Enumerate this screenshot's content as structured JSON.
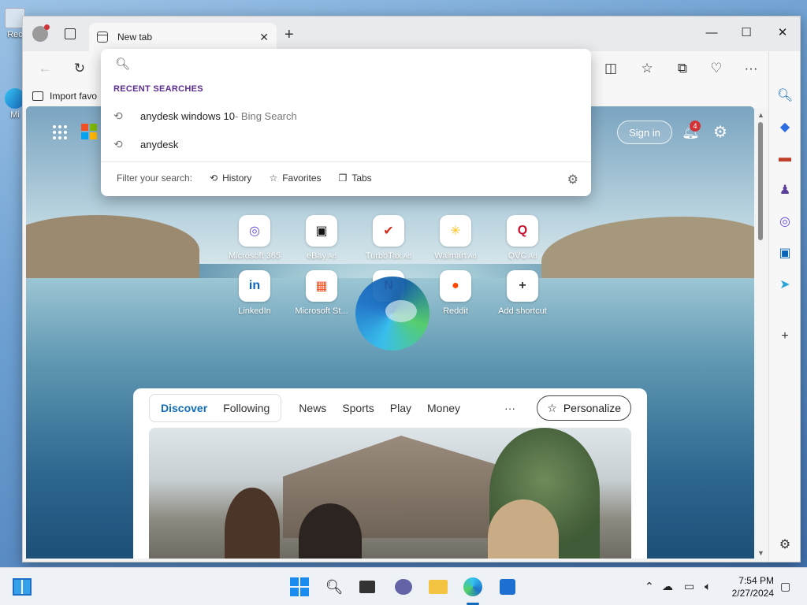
{
  "desktop": {
    "icons": [
      {
        "label": "Rec"
      },
      {
        "label": "Mi"
      }
    ]
  },
  "browser": {
    "tab": {
      "title": "New tab"
    },
    "favorites_bar": {
      "import_label": "Import favo"
    },
    "omnibox": {
      "section_label": "RECENT SEARCHES",
      "items": [
        {
          "text": "anydesk windows 10",
          "suffix": " - Bing Search"
        },
        {
          "text": "anydesk",
          "suffix": ""
        }
      ],
      "filter_label": "Filter your search:",
      "filters": [
        "History",
        "Favorites",
        "Tabs"
      ]
    }
  },
  "newtab": {
    "signin_label": "Sign in",
    "notification_count": "4",
    "shortcuts": [
      {
        "label": "Microsoft 365",
        "ad": "",
        "glyph": "◎",
        "color": "#6b4fd8"
      },
      {
        "label": "eBay",
        "ad": "Ad",
        "glyph": "▣",
        "color": "#111"
      },
      {
        "label": "TurboTax",
        "ad": "Ad",
        "glyph": "✔",
        "color": "#d52b1e"
      },
      {
        "label": "Walmart",
        "ad": "Ad",
        "glyph": "✳",
        "color": "#ffc220"
      },
      {
        "label": "QVC",
        "ad": "Ad",
        "glyph": "Q",
        "color": "#c8102e"
      },
      {
        "label": "LinkedIn",
        "ad": "",
        "glyph": "in",
        "color": "#0a66c2"
      },
      {
        "label": "Microsoft St...",
        "ad": "",
        "glyph": "▦",
        "color": "#f25022"
      },
      {
        "label": "Netflix",
        "ad": "",
        "glyph": "N",
        "color": "#e50914"
      },
      {
        "label": "Reddit",
        "ad": "",
        "glyph": "●",
        "color": "#ff4500"
      },
      {
        "label": "Add shortcut",
        "ad": "",
        "glyph": "+",
        "color": "#333"
      }
    ],
    "feed": {
      "segment_tabs": [
        "Discover",
        "Following"
      ],
      "tabs": [
        "News",
        "Sports",
        "Play",
        "Money"
      ],
      "more": "···",
      "personalize_label": "Personalize"
    }
  },
  "taskbar": {
    "time": "7:54 PM",
    "date": "2/27/2024"
  }
}
